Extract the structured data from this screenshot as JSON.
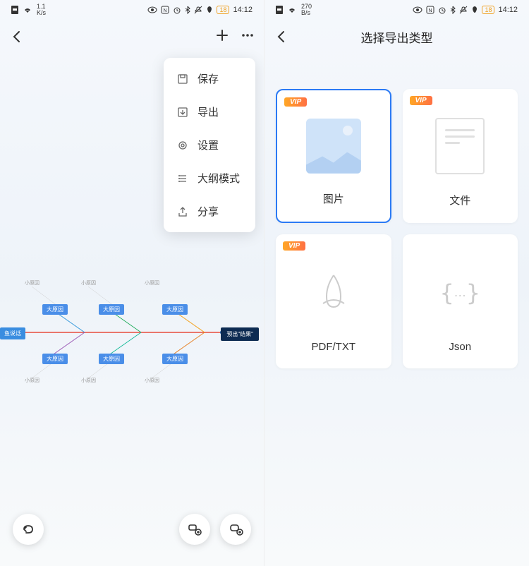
{
  "statusBar": {
    "netSpeedLeft": "1.1\nK/s",
    "netSpeedRight": "270\nB/s",
    "time": "14:12",
    "battery": "18"
  },
  "leftScreen": {
    "menu": {
      "items": [
        {
          "icon": "save-icon",
          "label": "保存"
        },
        {
          "icon": "export-icon",
          "label": "导出"
        },
        {
          "icon": "settings-icon",
          "label": "设置"
        },
        {
          "icon": "outline-icon",
          "label": "大纲模式"
        },
        {
          "icon": "share-icon",
          "label": "分享"
        }
      ]
    },
    "fishbone": {
      "rootLabel": "鱼说话",
      "resultLabel": "预出\"结果\"",
      "mainNodes": [
        "大原因",
        "大原因",
        "大原因",
        "大原因",
        "大原因",
        "大原因"
      ],
      "smallLabel": "小原因"
    }
  },
  "rightScreen": {
    "title": "选择导出类型",
    "exportOptions": [
      {
        "label": "图片",
        "vip": true,
        "selected": true,
        "iconType": "image"
      },
      {
        "label": "文件",
        "vip": true,
        "selected": false,
        "iconType": "doc"
      },
      {
        "label": "PDF/TXT",
        "vip": true,
        "selected": false,
        "iconType": "pdf"
      },
      {
        "label": "Json",
        "vip": false,
        "selected": false,
        "iconType": "json"
      }
    ],
    "vipLabel": "VIP"
  }
}
